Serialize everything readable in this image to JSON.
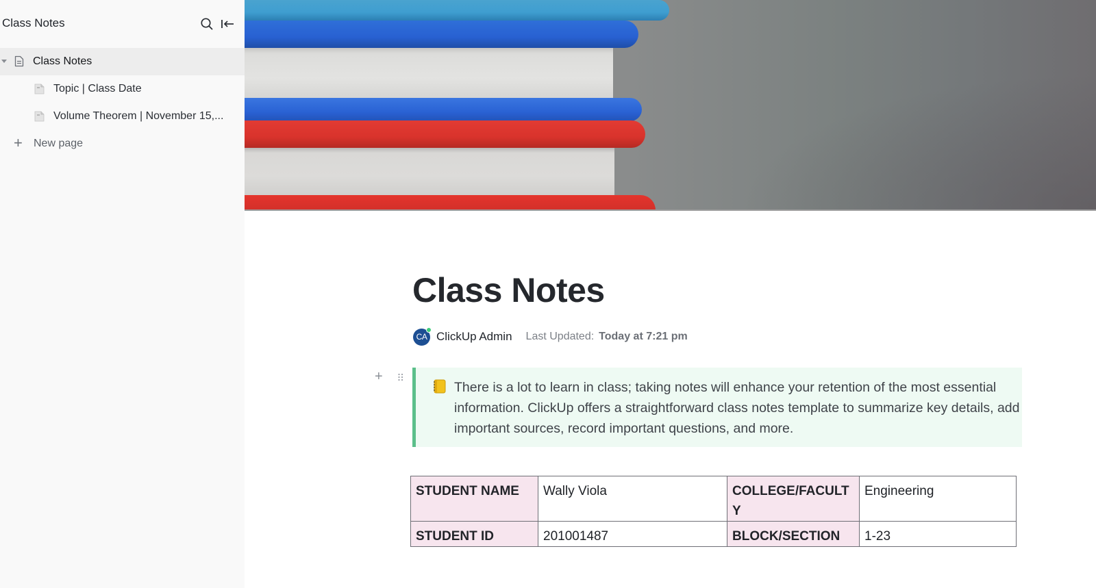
{
  "sidebar": {
    "title": "Class Notes",
    "search_icon": "search-icon",
    "collapse_icon": "collapse-sidebar-icon",
    "items": [
      {
        "label": "Class Notes",
        "icon": "document-icon",
        "active": true,
        "expanded": true
      }
    ],
    "children": [
      {
        "label": "Topic | Class Date",
        "icon": "page-icon"
      },
      {
        "label": "Volume Theorem | November 15,...",
        "icon": "page-icon"
      }
    ],
    "new_page_label": "New page"
  },
  "cover": {
    "description": "Stack of blue and red hardcover books"
  },
  "document": {
    "title": "Class Notes",
    "author": {
      "initials": "CA",
      "name": "ClickUp Admin",
      "status": "online"
    },
    "last_updated_label": "Last Updated:",
    "last_updated_value": "Today at 7:21 pm",
    "callout": {
      "emoji": "notebook",
      "text": "There is a lot to learn in class; taking notes will enhance your retention of the most essential information. ClickUp offers a  straightforward class notes template to summarize key details, add important sources, record important questions, and more.",
      "accent": "#5bbf8a",
      "background": "#eefaf3"
    },
    "table": {
      "header_background": "#f7e5ee",
      "rows": [
        {
          "label1": "STUDENT NAME",
          "value1": "Wally Viola",
          "label2": "COLLEGE/FACULTY",
          "value2": "Engineering"
        },
        {
          "label1": "STUDENT ID",
          "value1": "201001487",
          "label2": "BLOCK/SECTION",
          "value2": "1-23"
        }
      ]
    }
  }
}
